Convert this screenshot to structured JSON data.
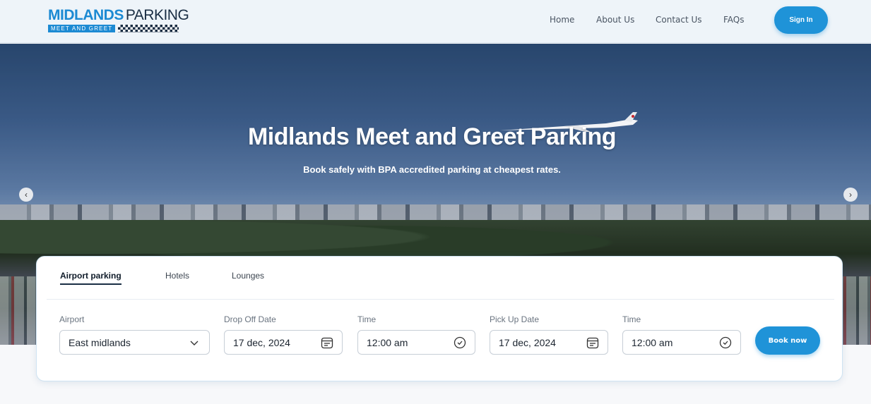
{
  "brand": {
    "name_part1": "MIDLANDS",
    "name_part2": "PARKING",
    "tagline": "MEET AND GREET"
  },
  "nav": {
    "items": [
      "Home",
      "About Us",
      "Contact Us",
      "FAQs"
    ],
    "signin_label": "Sign In"
  },
  "hero": {
    "title": "Midlands Meet and Greet Parking",
    "subtitle": "Book safely with BPA accredited parking at cheapest rates.",
    "prev_icon": "chevron-left-icon",
    "next_icon": "chevron-right-icon"
  },
  "booking": {
    "tabs": [
      "Airport parking",
      "Hotels",
      "Lounges"
    ],
    "active_tab": "Airport parking",
    "fields": {
      "airport_label": "Airport",
      "airport_value": "East midlands",
      "dropoff_date_label": "Drop Off Date",
      "dropoff_date_value": "17 dec, 2024",
      "dropoff_time_label": "Time",
      "dropoff_time_value": "12:00 am",
      "pickup_date_label": "Pick Up Date",
      "pickup_date_value": "17 dec, 2024",
      "pickup_time_label": "Time",
      "pickup_time_value": "12:00 am"
    },
    "book_label": "Book now"
  },
  "colors": {
    "accent": "#1f93d8",
    "brand_blue": "#1c8ad3",
    "brand_dark": "#1a2e44"
  }
}
